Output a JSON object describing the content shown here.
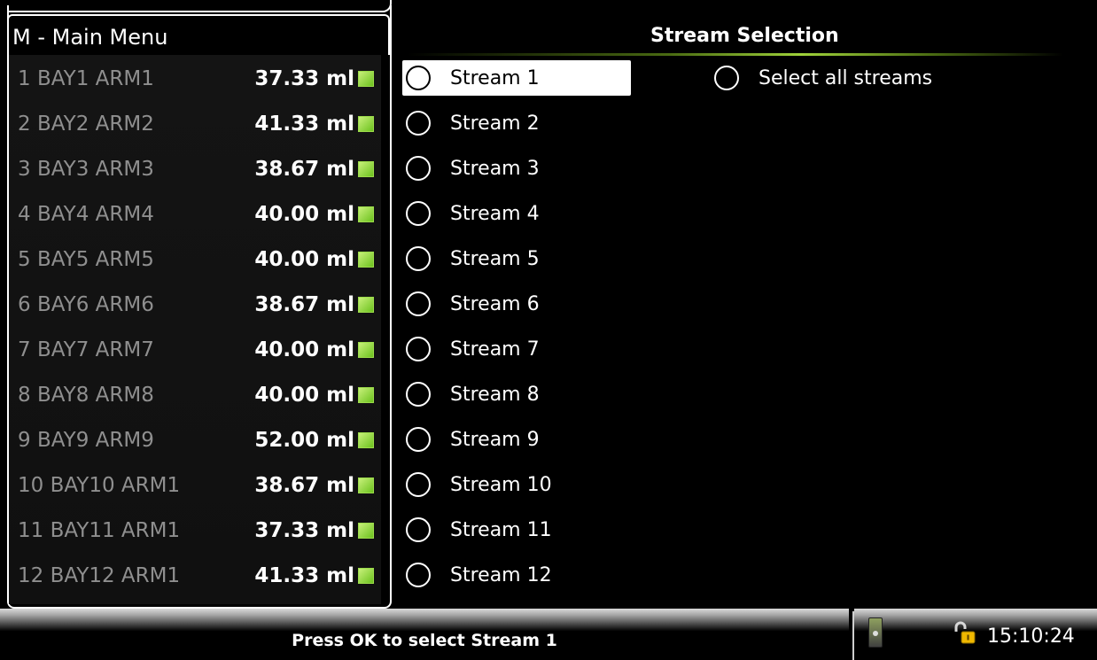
{
  "menu": {
    "title": "M - Main Menu"
  },
  "bays": [
    {
      "label": "1   BAY1 ARM1",
      "value": "37.33 ml"
    },
    {
      "label": "2   BAY2 ARM2",
      "value": "41.33 ml"
    },
    {
      "label": "3   BAY3 ARM3",
      "value": "38.67 ml"
    },
    {
      "label": "4   BAY4 ARM4",
      "value": "40.00 ml"
    },
    {
      "label": "5   BAY5 ARM5",
      "value": "40.00 ml"
    },
    {
      "label": "6   BAY6 ARM6",
      "value": "38.67 ml"
    },
    {
      "label": "7   BAY7 ARM7",
      "value": "40.00 ml"
    },
    {
      "label": "8   BAY8 ARM8",
      "value": "40.00 ml"
    },
    {
      "label": "9   BAY9 ARM9",
      "value": "52.00 ml"
    },
    {
      "label": "10 BAY10 ARM1",
      "value": "38.67 ml"
    },
    {
      "label": "11 BAY11 ARM1",
      "value": "37.33 ml"
    },
    {
      "label": "12 BAY12 ARM1",
      "value": "41.33 ml"
    }
  ],
  "stream_selection": {
    "title": "Stream Selection",
    "select_all_label": "Select all streams",
    "streams": [
      "Stream 1",
      "Stream 2",
      "Stream 3",
      "Stream 4",
      "Stream 5",
      "Stream 6",
      "Stream 7",
      "Stream 8",
      "Stream 9",
      "Stream 10",
      "Stream 11",
      "Stream 12"
    ],
    "selected_stream": "Stream 1"
  },
  "status_bar": {
    "message": "Press OK to select Stream 1",
    "time": "15:10:24"
  },
  "colors": {
    "status_indicator": "#7ed321",
    "highlight": "#ffffff",
    "dim_text": "#8f8f8f"
  },
  "icons": {
    "status_indicator": "green-square-icon",
    "device": "handheld-device-icon",
    "lock": "unlocked-padlock-icon"
  }
}
